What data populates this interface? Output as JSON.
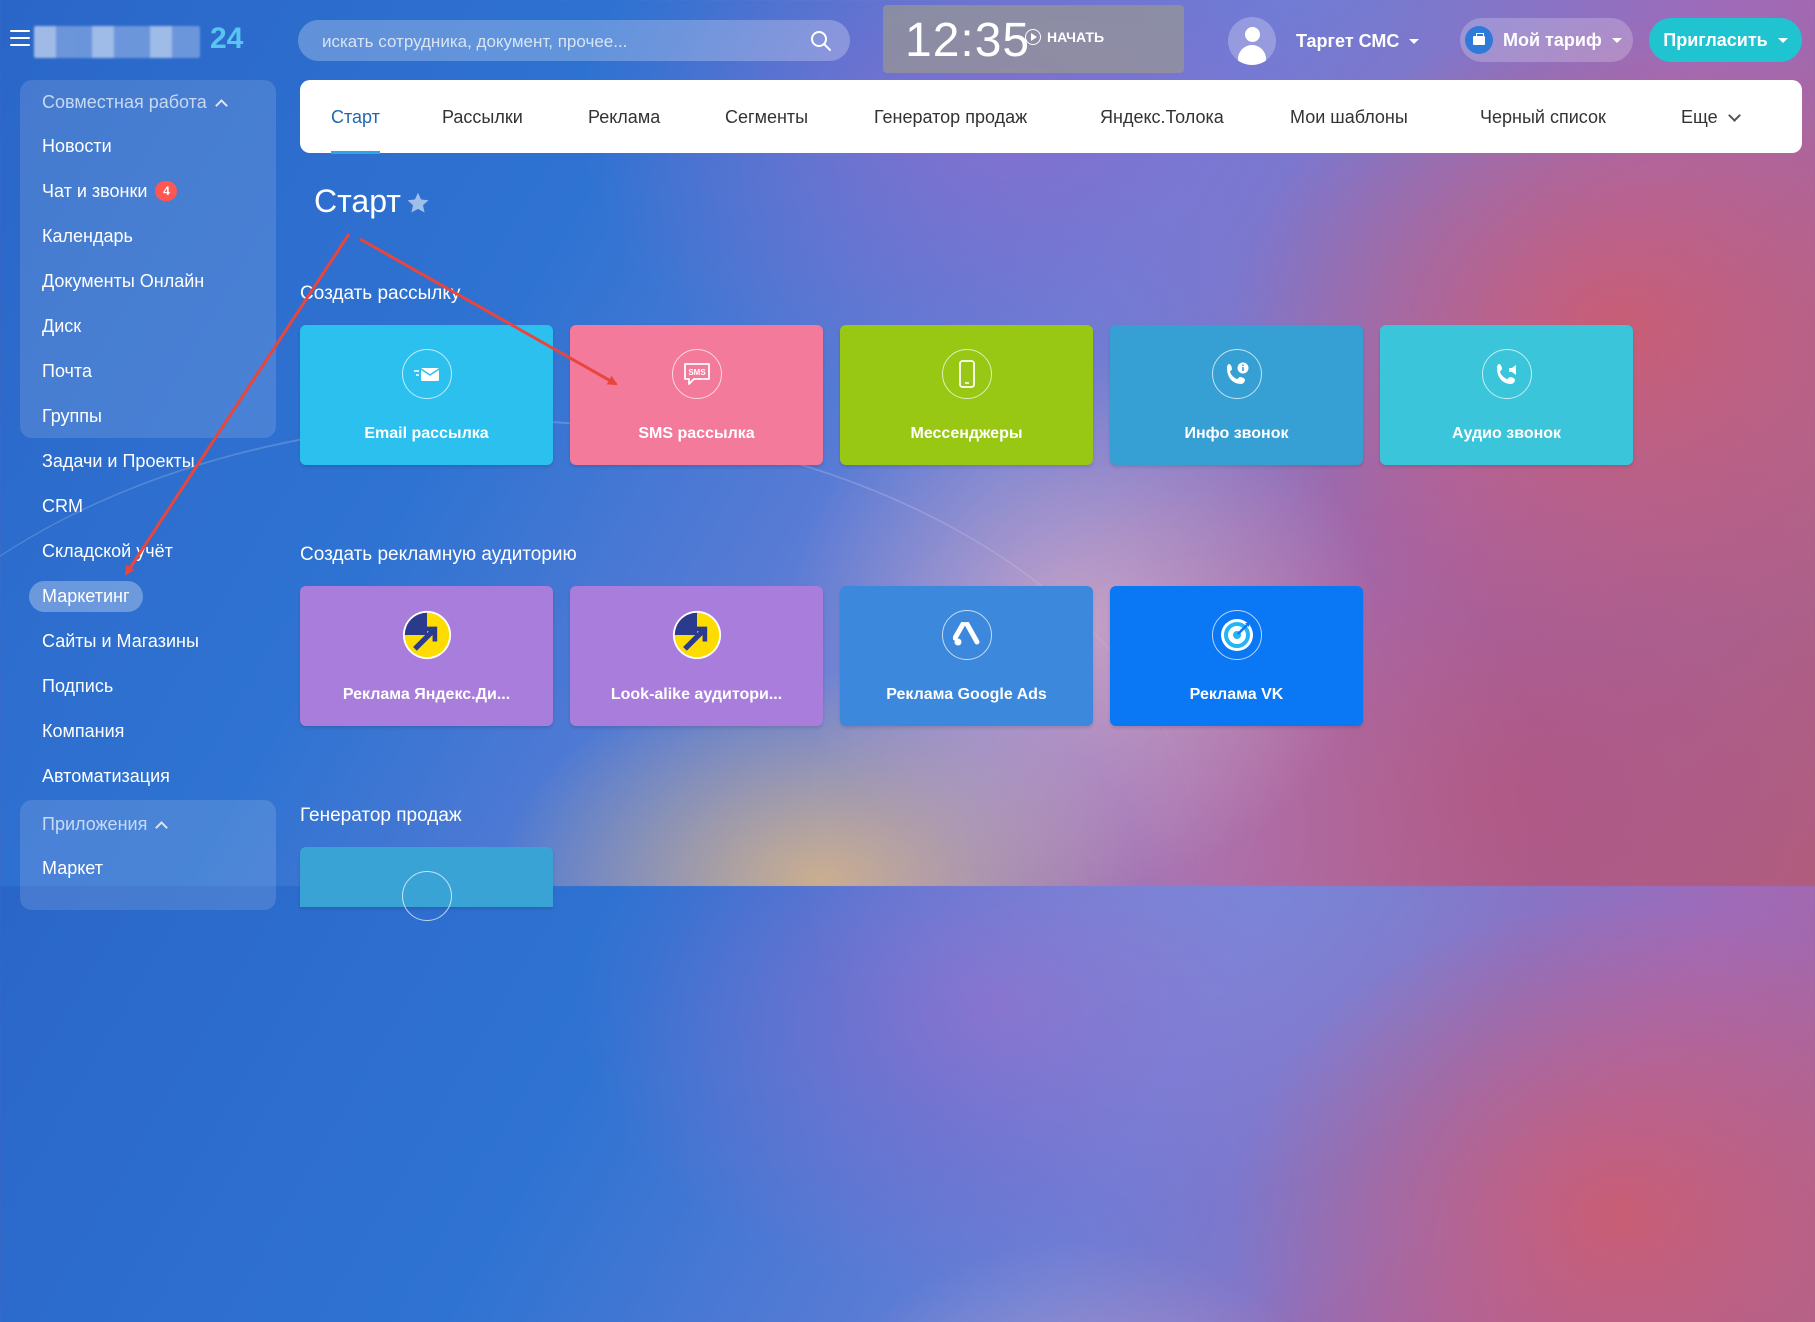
{
  "header": {
    "logo_suffix": "24",
    "search_placeholder": "искать сотрудника, документ, прочее...",
    "clock_time": "12:35",
    "clock_start": "НАЧАТЬ",
    "user_name": "Таргет СМС",
    "tariff_label": "Мой тариф",
    "invite_label": "Пригласить"
  },
  "sidebar": {
    "group1_title": "Совместная работа",
    "group1_items": [
      "Новости",
      "Чат и звонки",
      "Календарь",
      "Документы Онлайн",
      "Диск",
      "Почта",
      "Группы"
    ],
    "chat_badge": "4",
    "items": [
      "Задачи и Проекты",
      "CRM",
      "Складской учёт",
      "Маркетинг",
      "Сайты и Магазины",
      "Подпись",
      "Компания",
      "Автоматизация"
    ],
    "active_item": "Маркетинг",
    "group2_title": "Приложения",
    "group2_items": [
      "Маркет"
    ]
  },
  "tabs": [
    "Старт",
    "Рассылки",
    "Реклама",
    "Сегменты",
    "Генератор продаж",
    "Яндекс.Толока",
    "Мои шаблоны",
    "Черный список",
    "Еще"
  ],
  "page": {
    "title": "Старт"
  },
  "sections": [
    {
      "title": "Создать рассылку",
      "tiles": [
        {
          "label": "Email рассылка",
          "icon": "email-icon",
          "color": "#2cc0ef"
        },
        {
          "label": "SMS рассылка",
          "icon": "sms-icon",
          "color": "#f47a9c"
        },
        {
          "label": "Мессенджеры",
          "icon": "smartphone-icon",
          "color": "#98c814"
        },
        {
          "label": "Инфо звонок",
          "icon": "info-call-icon",
          "color": "#36a0d4"
        },
        {
          "label": "Аудио звонок",
          "icon": "audio-call-icon",
          "color": "#3ac5da"
        }
      ]
    },
    {
      "title": "Создать рекламную аудиторию",
      "tiles": [
        {
          "label": "Реклама Яндекс.Ди...",
          "icon": "yandex-direct-icon",
          "color": "#a97ddc"
        },
        {
          "label": "Look-alike аудитори...",
          "icon": "yandex-direct-icon",
          "color": "#a97ddc"
        },
        {
          "label": "Реклама Google Ads",
          "icon": "google-ads-icon",
          "color": "#3b88dc"
        },
        {
          "label": "Реклама VK",
          "icon": "vk-icon",
          "color": "#0a77f5"
        }
      ]
    },
    {
      "title": "Генератор продаж",
      "tiles": [
        {
          "label": "",
          "icon": "sales-generator-icon",
          "color": "#3aa3d6"
        }
      ]
    }
  ],
  "colors": {
    "accent": "#2fa6e8",
    "invite_button": "#20c3d0",
    "badge": "#ff5752",
    "annotation_arrow": "#e8453c"
  }
}
